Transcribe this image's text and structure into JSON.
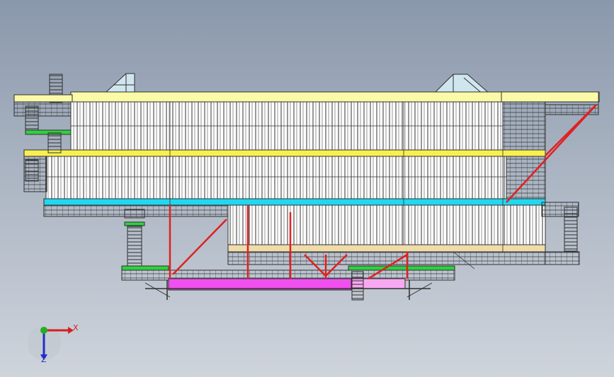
{
  "viewport": {
    "background_top": "#8a98ac",
    "background_bottom": "#cfd4dc"
  },
  "model": {
    "description_icon": "structural-assembly",
    "colors": {
      "wall": "#ffffff",
      "ridge": "#fafaa8",
      "belt_yellow": "#f8f050",
      "belt_cyan": "#20d8f0",
      "base_tan": "#f0dcaa",
      "brace_red": "#e02020",
      "walkway_green": "#30d040",
      "tray_magenta": "#f050f0",
      "frame_line": "#303030"
    }
  },
  "triad": {
    "x_label": "X",
    "z_label": "Z",
    "x_color": "#d32020",
    "y_color": "#20b020",
    "z_color": "#2030c8"
  }
}
